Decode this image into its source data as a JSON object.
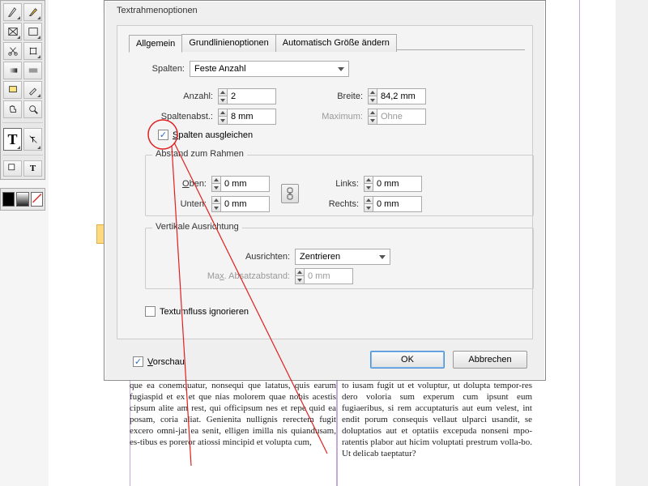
{
  "dialog": {
    "title": "Textrahmenoptionen",
    "tabs": [
      "Allgemein",
      "Grundlinienoptionen",
      "Automatisch Größe ändern"
    ],
    "active_tab": 0,
    "columns_section": {
      "spalten_label": "Spalten:",
      "spalten_dropdown": "Feste Anzahl",
      "anzahl_label": "Anzahl:",
      "anzahl_value": "2",
      "spaltenabst_label": "Spaltenabst.:",
      "spaltenabst_value": "8 mm",
      "breite_label": "Breite:",
      "breite_value": "84,2 mm",
      "maximum_label": "Maximum:",
      "maximum_value": "Ohne",
      "balance_checkbox_label": "Spalten ausgleichen",
      "balance_checked": true
    },
    "inset_section": {
      "title": "Abstand zum Rahmen",
      "oben_label": "Oben:",
      "oben_value": "0 mm",
      "unten_label": "Unten:",
      "unten_value": "0 mm",
      "links_label": "Links:",
      "links_value": "0 mm",
      "rechts_label": "Rechts:",
      "rechts_value": "0 mm"
    },
    "valign_section": {
      "title": "Vertikale Ausrichtung",
      "ausrichten_label": "Ausrichten:",
      "ausrichten_value": "Zentrieren",
      "maxabstand_label": "Max. Absatzabstand:",
      "maxabstand_value": "0 mm"
    },
    "ignore_wrap_label": "Textumfluss ignorieren",
    "ignore_wrap_checked": false,
    "preview_label": "Vorschau",
    "preview_checked": true,
    "ok_label": "OK",
    "cancel_label": "Abbrechen"
  },
  "body_text": {
    "col1": "que ea conemquatur, nonsequi que latatus, quis earum fugiaspid et ex et que nias molorem quae nobis acestis cipsum alite am rest, qui officipsum nes et repe quid ea posam, coria aliat.\nGenienita nullignis rerectem fugit excero omni-jat ea senit, elligen imilla nis quiandusam, es-tibus es poreror atiossi mincipid et volupta cum,",
    "col2": "to iusam fugit ut et voluptur, ut dolupta tempor-res dero voloria sum experum cum ipsunt eum fugiaeribus, si rem accuptaturis aut eum velest, int endit porum consequis vellaut ulparci usandit, se doluptatios aut et optatiis excepuda nonseni mpo-ratentis plabor aut hicim voluptati prestrum volla-bo. Ut delicab taeptatur?"
  }
}
